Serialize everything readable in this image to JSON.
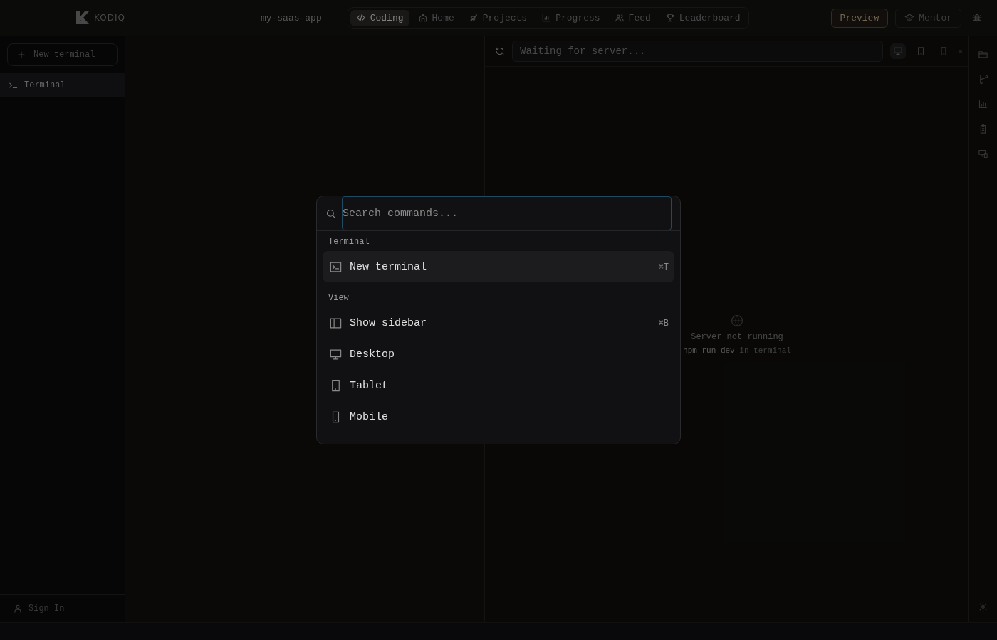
{
  "header": {
    "logo": "KODIQ",
    "project": "my-saas-app",
    "tabs": [
      {
        "label": "Coding",
        "selected": true
      },
      {
        "label": "Home",
        "selected": false
      },
      {
        "label": "Projects",
        "selected": false
      },
      {
        "label": "Progress",
        "selected": false
      },
      {
        "label": "Feed",
        "selected": false
      },
      {
        "label": "Leaderboard",
        "selected": false
      }
    ],
    "preview_button": "Preview",
    "mentor_button": "Mentor"
  },
  "sidebar": {
    "new_button": "New terminal",
    "items": [
      {
        "label": "Terminal",
        "selected": true
      }
    ],
    "sign_in": "Sign In"
  },
  "preview": {
    "url_placeholder": "Waiting for server...",
    "devices": [
      {
        "selected": true
      },
      {
        "selected": false
      },
      {
        "selected": false
      }
    ],
    "empty_title": "Server not running",
    "command": "npm run dev",
    "command_suffix": " in terminal"
  },
  "palette": {
    "placeholder": "Search commands...",
    "groups": [
      {
        "heading": "Terminal",
        "items": [
          {
            "label": "New terminal",
            "shortcut": "⌘T",
            "selected": true
          }
        ]
      },
      {
        "heading": "View",
        "items": [
          {
            "label": "Show sidebar",
            "shortcut": "⌘B",
            "selected": false
          },
          {
            "label": "Desktop",
            "selected": false
          },
          {
            "label": "Tablet",
            "selected": false
          },
          {
            "label": "Mobile",
            "selected": false
          }
        ]
      }
    ]
  }
}
